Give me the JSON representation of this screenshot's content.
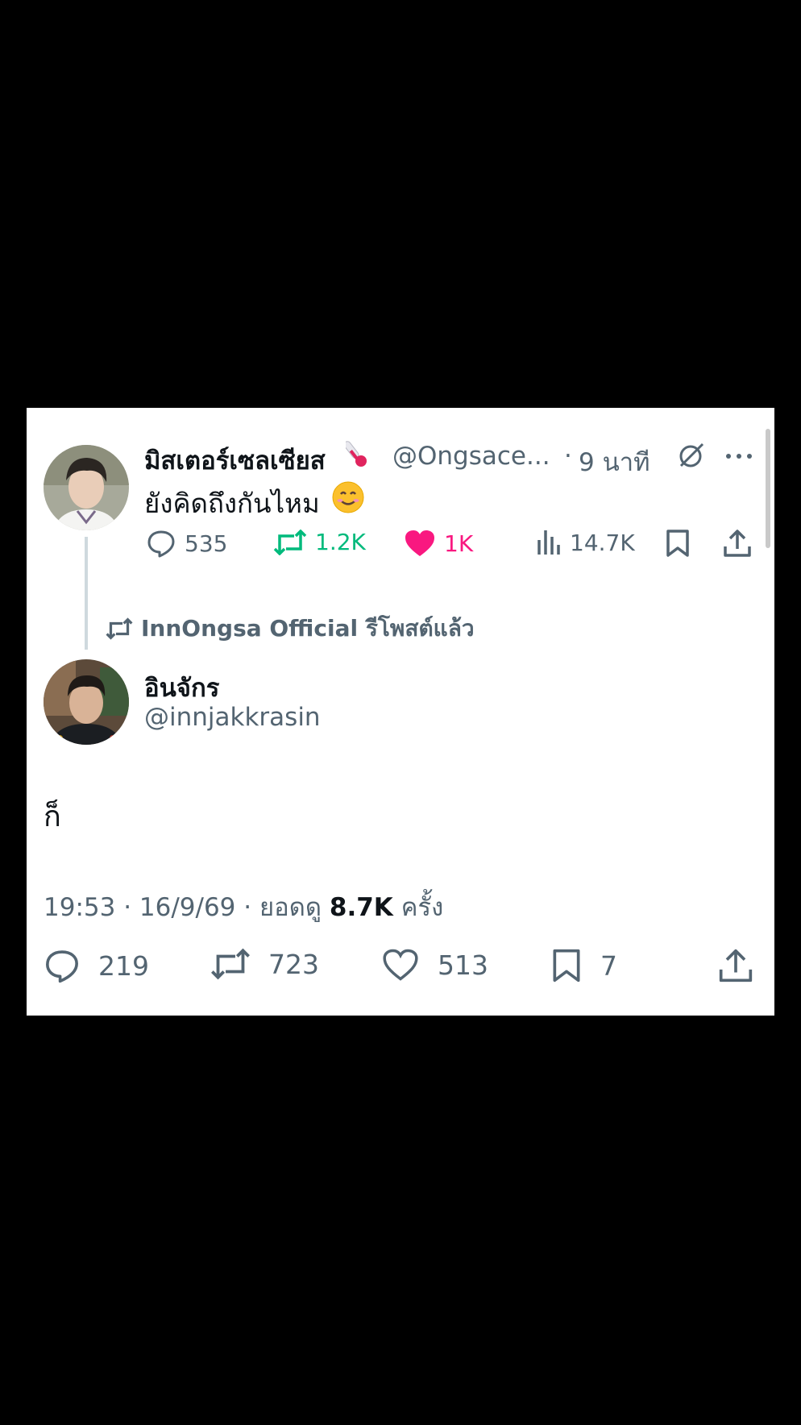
{
  "quoted_post": {
    "display_name": "มิสเตอร์เซลเซียส",
    "handle": "@Ongsace...",
    "separator": "·",
    "time_ago": "9 นาที",
    "text": "ยังคิดถึงกันไหม",
    "replies": "535",
    "reposts": "1.2K",
    "likes": "1K",
    "views": "14.7K"
  },
  "repost_banner": {
    "label": "InnOngsa Official รีโพสต์แล้ว"
  },
  "main_post": {
    "display_name": "อินจักร",
    "handle": "@innjakkrasin",
    "text": "ก็",
    "timestamp": "19:53 · 16/9/69 · ยอดดู",
    "view_count": "8.7K",
    "view_suffix": "ครั้ง",
    "replies": "219",
    "reposts": "723",
    "likes": "513",
    "bookmarks": "7"
  },
  "colors": {
    "repost_active": "#00ba7c",
    "like_active": "#f91880",
    "muted": "#536471",
    "text": "#0f1419"
  }
}
